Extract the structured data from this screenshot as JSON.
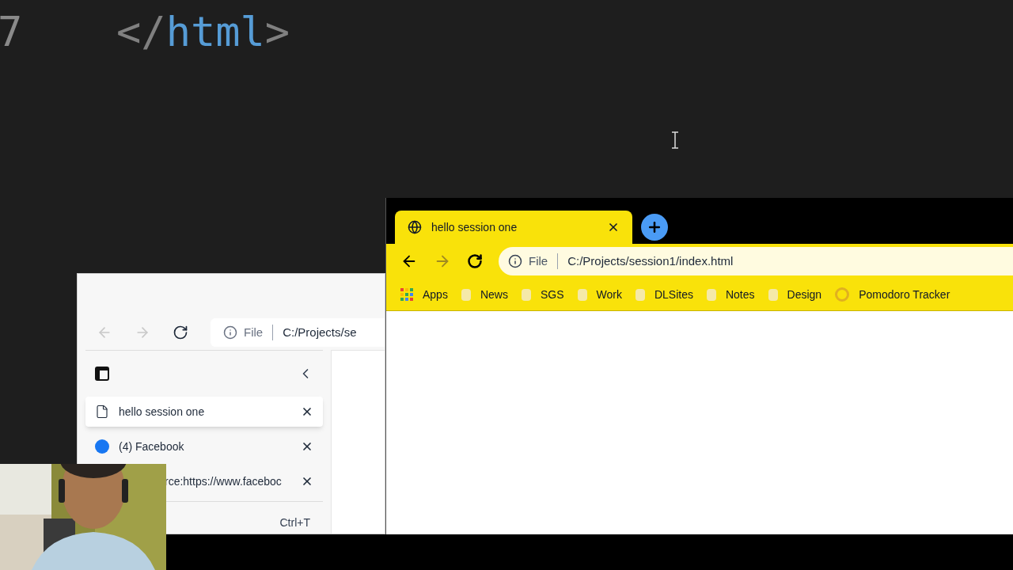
{
  "editor": {
    "line_number": "7",
    "tag_open": "</",
    "tag_name": "html",
    "tag_close": ">"
  },
  "edge_window": {
    "address": {
      "scheme": "File",
      "url": "C:/Projects/se"
    },
    "tabs": [
      {
        "kind": "page",
        "title": "hello session one",
        "selected": true
      },
      {
        "kind": "facebook",
        "title": "(4) Facebook",
        "selected": false
      },
      {
        "kind": "none",
        "title": "rce:https://www.faceboc",
        "selected": false
      }
    ],
    "shortcut": "Ctrl+T"
  },
  "chrome_window": {
    "tab": {
      "title": "hello session one",
      "selected": true
    },
    "address": {
      "scheme": "File",
      "url": "C:/Projects/session1/index.html"
    },
    "bookmarks": [
      {
        "kind": "apps",
        "label": "Apps"
      },
      {
        "kind": "folder",
        "label": "News"
      },
      {
        "kind": "folder",
        "label": "SGS"
      },
      {
        "kind": "folder",
        "label": "Work"
      },
      {
        "kind": "folder",
        "label": "DLSites"
      },
      {
        "kind": "folder",
        "label": "Notes"
      },
      {
        "kind": "folder",
        "label": "Design"
      },
      {
        "kind": "ring",
        "label": "Pomodoro Tracker"
      }
    ]
  }
}
